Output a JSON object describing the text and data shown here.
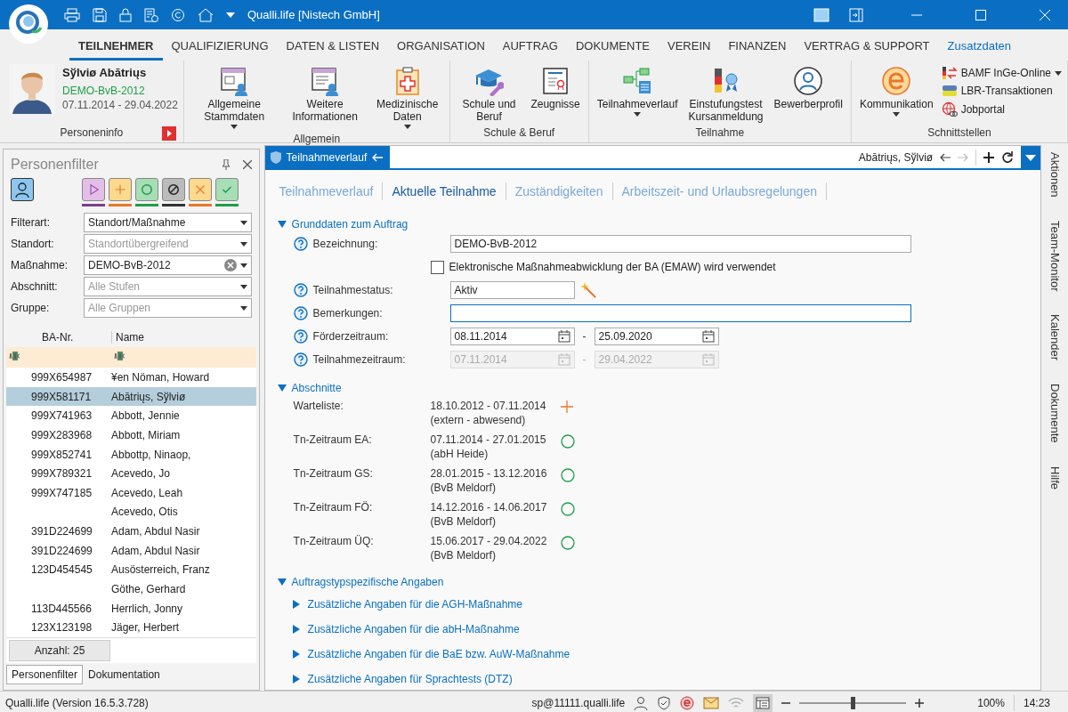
{
  "title_bar": {
    "title": "Qualli.life [Nistech GmbH]"
  },
  "ribbon_tabs": [
    {
      "label": "TEILNEHMER",
      "selected": true,
      "kind": "tab"
    },
    {
      "label": "QUALIFIZIERUNG",
      "selected": false,
      "kind": "tab"
    },
    {
      "label": "DATEN & LISTEN",
      "selected": false,
      "kind": "tab"
    },
    {
      "label": "ORGANISATION",
      "selected": false,
      "kind": "tab"
    },
    {
      "label": "AUFTRAG",
      "selected": false,
      "kind": "tab"
    },
    {
      "label": "DOKUMENTE",
      "selected": false,
      "kind": "tab"
    },
    {
      "label": "VEREIN",
      "selected": false,
      "kind": "tab"
    },
    {
      "label": "FINANZEN",
      "selected": false,
      "kind": "tab"
    },
    {
      "label": "VERTRAG & SUPPORT",
      "selected": false,
      "kind": "tab"
    },
    {
      "label": "Zusatzdaten",
      "selected": false,
      "kind": "extra"
    }
  ],
  "person": {
    "name": "Sўlviø Abātriųs",
    "measure": "DEMO-BvB-2012",
    "period": "07.11.2014 - 29.04.2022",
    "group_label": "Personeninfo"
  },
  "ribbon_groups": [
    {
      "label": "Allgemein",
      "items": [
        {
          "label": "Allgemeine Stammdaten",
          "dropdown": true,
          "kind": "large"
        },
        {
          "label": "Weitere Informationen",
          "dropdown": false,
          "kind": "large"
        },
        {
          "label": "Medizinische Daten",
          "dropdown": true,
          "kind": "large"
        }
      ]
    },
    {
      "label": "Schule & Beruf",
      "items": [
        {
          "label": "Schule und Beruf",
          "dropdown": false,
          "kind": "large"
        },
        {
          "label": "Zeugnisse",
          "dropdown": false,
          "kind": "large"
        }
      ]
    },
    {
      "label": "Teilnahme",
      "items": [
        {
          "label": "Teilnahmeverlauf",
          "dropdown": true,
          "kind": "large"
        },
        {
          "label": "Einstufungstest Kursanmeldung",
          "dropdown": false,
          "kind": "large"
        },
        {
          "label": "Bewerberprofil",
          "dropdown": false,
          "kind": "large"
        }
      ]
    },
    {
      "label": "Schnittstellen",
      "items": [
        {
          "label": "Kommunikation",
          "dropdown": true,
          "kind": "large"
        },
        {
          "label": "BAMF InGe-Online",
          "dropdown": true,
          "kind": "small"
        },
        {
          "label": "LBR-Transaktionen",
          "dropdown": false,
          "kind": "small"
        },
        {
          "label": "Jobportal",
          "dropdown": false,
          "kind": "small"
        }
      ]
    }
  ],
  "filter_panel": {
    "title": "Personenfilter",
    "status_filters": [
      {
        "kind": "play",
        "color": "#7b3f8c"
      },
      {
        "kind": "plus",
        "color": "#e8782a"
      },
      {
        "kind": "circle",
        "color": "#1e9e48"
      },
      {
        "kind": "blocked",
        "color": "#333333"
      },
      {
        "kind": "cross",
        "color": "#e8782a"
      },
      {
        "kind": "check",
        "color": "#1e9e48"
      }
    ],
    "filters": [
      {
        "label": "Filterart:",
        "value": "Standort/Maßnahme",
        "clearable": false
      },
      {
        "label": "Standort:",
        "placeholder": "Standortübergreifend",
        "clearable": false
      },
      {
        "label": "Maßnahme:",
        "value": "DEMO-BvB-2012",
        "clearable": true
      },
      {
        "label": "Abschnitt:",
        "placeholder": "Alle Stufen",
        "clearable": false
      },
      {
        "label": "Gruppe:",
        "placeholder": "Alle Gruppen",
        "clearable": false
      }
    ],
    "columns": [
      "BA-Nr.",
      "Name"
    ],
    "rows": [
      {
        "ba_nr": "999X654987",
        "name": "¥en Nöman, Howard",
        "selected": false
      },
      {
        "ba_nr": "999X581171",
        "name": "Abātriųs, Sўlviø",
        "selected": true
      },
      {
        "ba_nr": "999X741963",
        "name": "Abbott, Jennie",
        "selected": false
      },
      {
        "ba_nr": "999X283968",
        "name": "Abbott, Miriam",
        "selected": false
      },
      {
        "ba_nr": "999X852741",
        "name": "Abbottp, Ninaop,",
        "selected": false
      },
      {
        "ba_nr": "999X789321",
        "name": "Acevedo, Jo",
        "selected": false
      },
      {
        "ba_nr": "999X747185",
        "name": "Acevedo, Leah",
        "selected": false
      },
      {
        "name": "Acevedo, Otis",
        "selected": false
      },
      {
        "ba_nr": "391D224699",
        "name": "Adam, Abdul Nasir",
        "selected": false
      },
      {
        "ba_nr": "391D224699",
        "name": "Adam, Abdul Nasir",
        "selected": false
      },
      {
        "ba_nr": "123D454545",
        "name": "Ausösterreich, Franz",
        "selected": false
      },
      {
        "name": "Göthe, Gerhard",
        "selected": false
      },
      {
        "ba_nr": "113D445566",
        "name": "Herrlich, Jonny",
        "selected": false
      },
      {
        "ba_nr": "123X123198",
        "name": "Jäger, Herbert",
        "selected": false
      }
    ],
    "count": "Anzahl: 25",
    "bottom_tabs": [
      {
        "label": "Personenfilter",
        "selected": true
      },
      {
        "label": "Dokumentation",
        "selected": false
      }
    ]
  },
  "document": {
    "tab": "Teilnahmeverlauf",
    "person": "Abātriųs, Sўlviø",
    "subtabs": [
      {
        "label": "Teilnahmeverlauf",
        "selected": false
      },
      {
        "label": "Aktuelle Teilnahme",
        "selected": true
      },
      {
        "label": "Zuständigkeiten",
        "selected": false
      },
      {
        "label": "Arbeitszeit- und Urlaubsregelungen",
        "selected": false
      }
    ],
    "basics": {
      "title": "Grunddaten zum Auftrag",
      "expanded": true,
      "fields": [
        {
          "kind": "text",
          "label": "Bezeichnung:",
          "value": "DEMO-BvB-2012",
          "focused": false
        },
        {
          "kind": "checkbox",
          "label": "Elektronische Maßnahmeabwicklung der BA (EMAW) wird verwendet",
          "checked": false
        },
        {
          "kind": "status",
          "label": "Teilnahmestatus:",
          "value": "Aktiv"
        },
        {
          "kind": "text",
          "label": "Bemerkungen:",
          "focused": true
        },
        {
          "kind": "range",
          "label": "Förderzeitraum:",
          "from": "08.11.2014",
          "separator": "-",
          "to": "25.09.2020",
          "disabled": false
        },
        {
          "kind": "range",
          "label": "Teilnahmezeitraum:",
          "from": "07.11.2014",
          "separator": "-",
          "to": "29.04.2022",
          "disabled": true
        }
      ]
    },
    "sections": {
      "title": "Abschnitte",
      "expanded": true,
      "rows": [
        {
          "label": "Warteliste:",
          "dates": "18.10.2012 - 07.11.2014",
          "note": "(extern - abwesend)",
          "kind": "plus"
        },
        {
          "label": "Tn-Zeitraum EA:",
          "dates": "07.11.2014 - 27.01.2015",
          "note": "(abH Heide)",
          "kind": "circle"
        },
        {
          "label": "Tn-Zeitraum GS:",
          "dates": "28.01.2015 - 13.12.2016",
          "note": "(BvB Meldorf)",
          "kind": "circle"
        },
        {
          "label": "Tn-Zeitraum FÖ:",
          "dates": "14.12.2016 - 14.06.2017",
          "note": "(BvB Meldorf)",
          "kind": "circle"
        },
        {
          "label": "Tn-Zeitraum ÜQ:",
          "dates": "15.06.2017 - 29.04.2022",
          "note": "(BvB Meldorf)",
          "kind": "circle"
        }
      ]
    },
    "specific": {
      "title": "Auftragstypspezifische Angaben",
      "expanded": true,
      "children": [
        {
          "title": "Zusätzliche Angaben für die AGH-Maßnahme",
          "expanded": false
        },
        {
          "title": "Zusätzliche Angaben für die abH-Maßnahme",
          "expanded": false
        },
        {
          "title": "Zusätzliche Angaben für die BaE bzw. AuW-Maßnahme",
          "expanded": false
        },
        {
          "title": "Zusätzliche Angaben für Sprachtests (DTZ)",
          "expanded": false
        }
      ]
    }
  },
  "side_tabs": [
    "Aktionen",
    "Team-Monitor",
    "Kalender",
    "Dokumente",
    "Hilfe"
  ],
  "status_bar": {
    "version": "Qualli.life (Version 16.5.3.728)",
    "user": "sp@11111.qualli.life",
    "zoom": {
      "level": 0.5
    },
    "zoom_text": "100%",
    "time": "14:23"
  }
}
